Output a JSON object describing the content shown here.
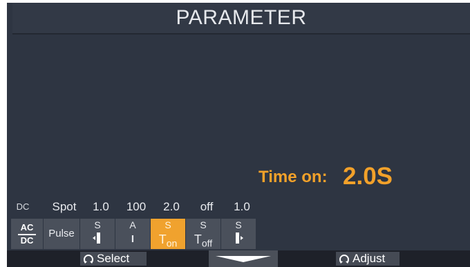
{
  "header": {
    "title": "PARAMETER"
  },
  "readout": {
    "label": "Time on:",
    "value": "2.0S"
  },
  "values_row": [
    "DC",
    "Spot",
    "1.0",
    "100",
    "2.0",
    "off",
    "1.0"
  ],
  "params": {
    "mode_top": "AC",
    "mode_bottom": "DC",
    "pulse_label": "Pulse",
    "cells": [
      {
        "unit": "S",
        "icon": "upslope-icon"
      },
      {
        "unit": "A",
        "symbol": "I"
      },
      {
        "unit": "S",
        "symbol": "T",
        "subscript": "on"
      },
      {
        "unit": "S",
        "symbol": "T",
        "subscript": "off"
      },
      {
        "unit": "S",
        "icon": "downslope-icon"
      }
    ]
  },
  "softkeys": {
    "select_label": "Select",
    "adjust_label": "Adjust"
  },
  "colors": {
    "accent": "#f0a22e",
    "background": "#2e3542",
    "tile": "#4a505b"
  }
}
